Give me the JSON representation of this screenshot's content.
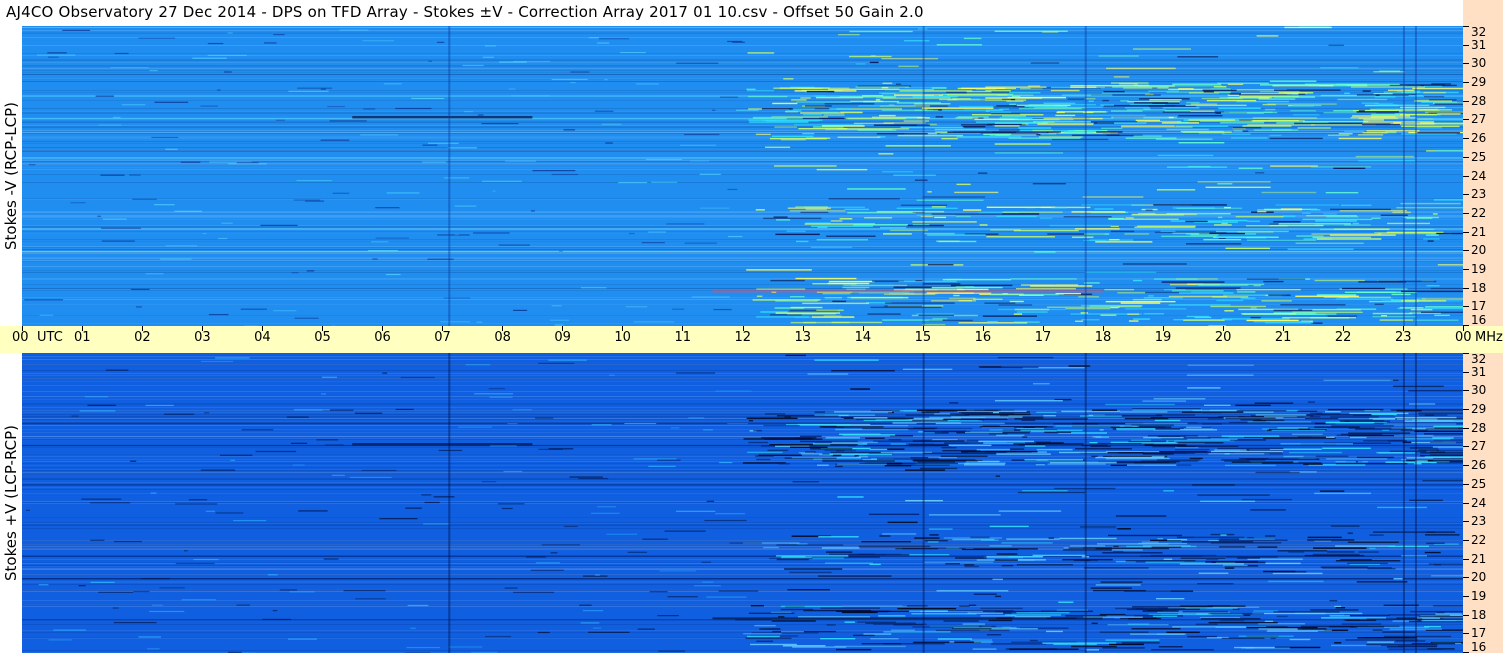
{
  "title": "AJ4CO Observatory  27 Dec 2014  -  DPS on TFD Array  -  Stokes ±V  -  Correction Array 2017 01 10.csv  -  Offset 50  Gain 2.0",
  "colors": {
    "upper_background": "#1f8ef0",
    "lower_background": "#0f5fe0",
    "time_axis_bg": "#ffffc0",
    "freq_axis_bg": "#ffe0c4",
    "highlight_bright": "#ccff66",
    "highlight_cyan": "#33e0ff",
    "highlight_dark": "#0a1a5a",
    "highlight_red": "#ff3333"
  },
  "chart_data": [
    {
      "type": "heatmap",
      "title": "",
      "ylabel": "Stokes -V  (RCP-LCP)",
      "xlabel": "",
      "x_unit": "UTC",
      "y_unit": "MHz",
      "x_ticks": [
        "00",
        "01",
        "02",
        "03",
        "04",
        "05",
        "06",
        "07",
        "08",
        "09",
        "10",
        "11",
        "12",
        "13",
        "14",
        "15",
        "16",
        "17",
        "18",
        "19",
        "20",
        "21",
        "22",
        "23",
        "00"
      ],
      "ylim": [
        16,
        32
      ],
      "y_ticks": [
        "16",
        "17",
        "18",
        "19",
        "20",
        "21",
        "22",
        "23",
        "24",
        "25",
        "26",
        "27",
        "28",
        "29",
        "30",
        "31",
        "32"
      ],
      "colormap": "blue-cyan-yellow (higher = brighter)"
    },
    {
      "type": "heatmap",
      "title": "",
      "ylabel": "Stokes +V  (LCP-RCP)",
      "xlabel": "",
      "x_unit": "UTC",
      "y_unit": "MHz",
      "x_ticks": [
        "00",
        "01",
        "02",
        "03",
        "04",
        "05",
        "06",
        "07",
        "08",
        "09",
        "10",
        "11",
        "12",
        "13",
        "14",
        "15",
        "16",
        "17",
        "18",
        "19",
        "20",
        "21",
        "22",
        "23",
        "00"
      ],
      "ylim": [
        16,
        32
      ],
      "y_ticks": [
        "16",
        "17",
        "18",
        "19",
        "20",
        "21",
        "22",
        "23",
        "24",
        "25",
        "26",
        "27",
        "28",
        "29",
        "30",
        "31",
        "32"
      ],
      "colormap": "blue-cyan-yellow (higher = brighter)"
    }
  ],
  "time_axis": {
    "labels": [
      "00",
      "01",
      "02",
      "03",
      "04",
      "05",
      "06",
      "07",
      "08",
      "09",
      "10",
      "11",
      "12",
      "13",
      "14",
      "15",
      "16",
      "17",
      "18",
      "19",
      "20",
      "21",
      "22",
      "23",
      "00"
    ],
    "utc_label": "UTC",
    "mhz_label": "MHz"
  }
}
